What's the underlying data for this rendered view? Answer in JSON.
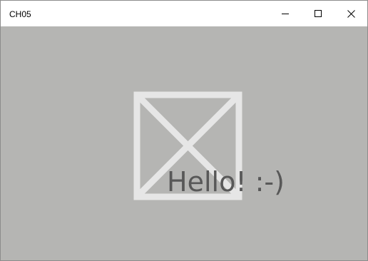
{
  "window": {
    "title": "CH05"
  },
  "content": {
    "greeting_text": "Hello! :-)",
    "image_icon": "image-placeholder-icon"
  },
  "colors": {
    "client_background": "#b5b5b3",
    "placeholder_stroke": "#e6e6e6",
    "text": "#585858"
  }
}
